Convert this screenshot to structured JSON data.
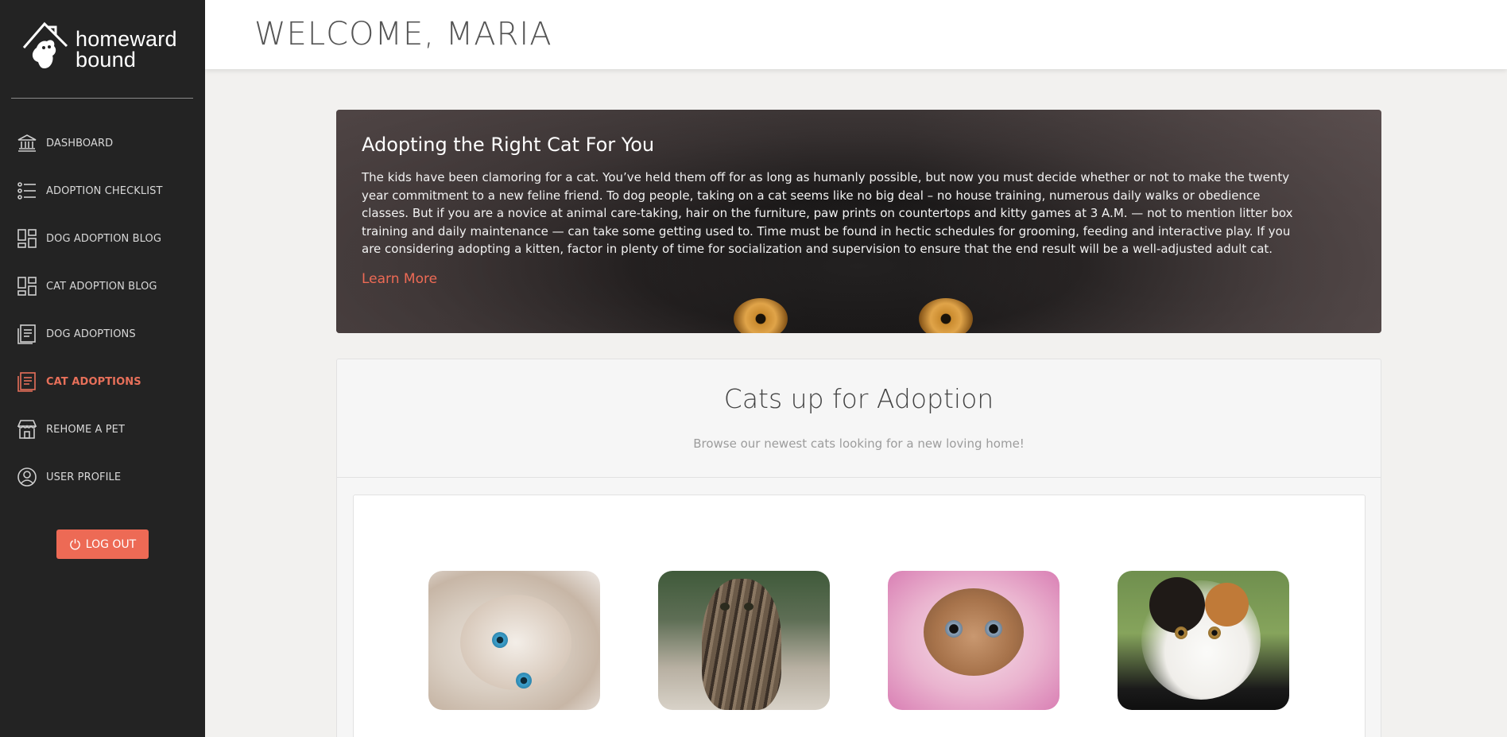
{
  "brand": {
    "name": "homeward bound"
  },
  "sidebar": {
    "items": [
      {
        "label": "DASHBOARD",
        "icon": "bank-icon",
        "active": false
      },
      {
        "label": "ADOPTION CHECKLIST",
        "icon": "list-icon",
        "active": false
      },
      {
        "label": "DOG ADOPTION BLOG",
        "icon": "dashboard-grid-icon",
        "active": false
      },
      {
        "label": "CAT ADOPTION BLOG",
        "icon": "dashboard-grid-icon",
        "active": false
      },
      {
        "label": "DOG ADOPTIONS",
        "icon": "document-icon",
        "active": false
      },
      {
        "label": "CAT ADOPTIONS",
        "icon": "document-icon",
        "active": true
      },
      {
        "label": "REHOME A PET",
        "icon": "store-icon",
        "active": false
      },
      {
        "label": "USER PROFILE",
        "icon": "user-circle-icon",
        "active": false
      }
    ],
    "logout_label": "LOG OUT"
  },
  "header": {
    "welcome": "WELCOME, MARIA"
  },
  "hero": {
    "title": "Adopting the Right Cat For You",
    "body": "The kids have been clamoring for a cat. You’ve held them off for as long as humanly possible, but now you must decide whether or not to make the twenty year commitment to a new feline friend. To dog people, taking on a cat seems like no big deal – no house training, numerous daily walks or obedience classes. But if you are a novice at animal care-taking, hair on the furniture, paw prints on countertops and kitty games at 3 A.M. — not to mention litter box training and daily maintenance — can take some getting used to. Time must be found in hectic schedules for grooming, feeding and interactive play. If you are considering adopting a kitten, factor in plenty of time for socialization and supervision to ensure that the end result will be a well-adjusted adult cat.",
    "link_label": "Learn More"
  },
  "adoption": {
    "title": "Cats up for Adoption",
    "subtitle": "Browse our newest cats looking for a new loving home!"
  },
  "colors": {
    "accent": "#ed6a55",
    "sidebar_bg": "#232323",
    "page_bg": "#f2f1ef"
  }
}
